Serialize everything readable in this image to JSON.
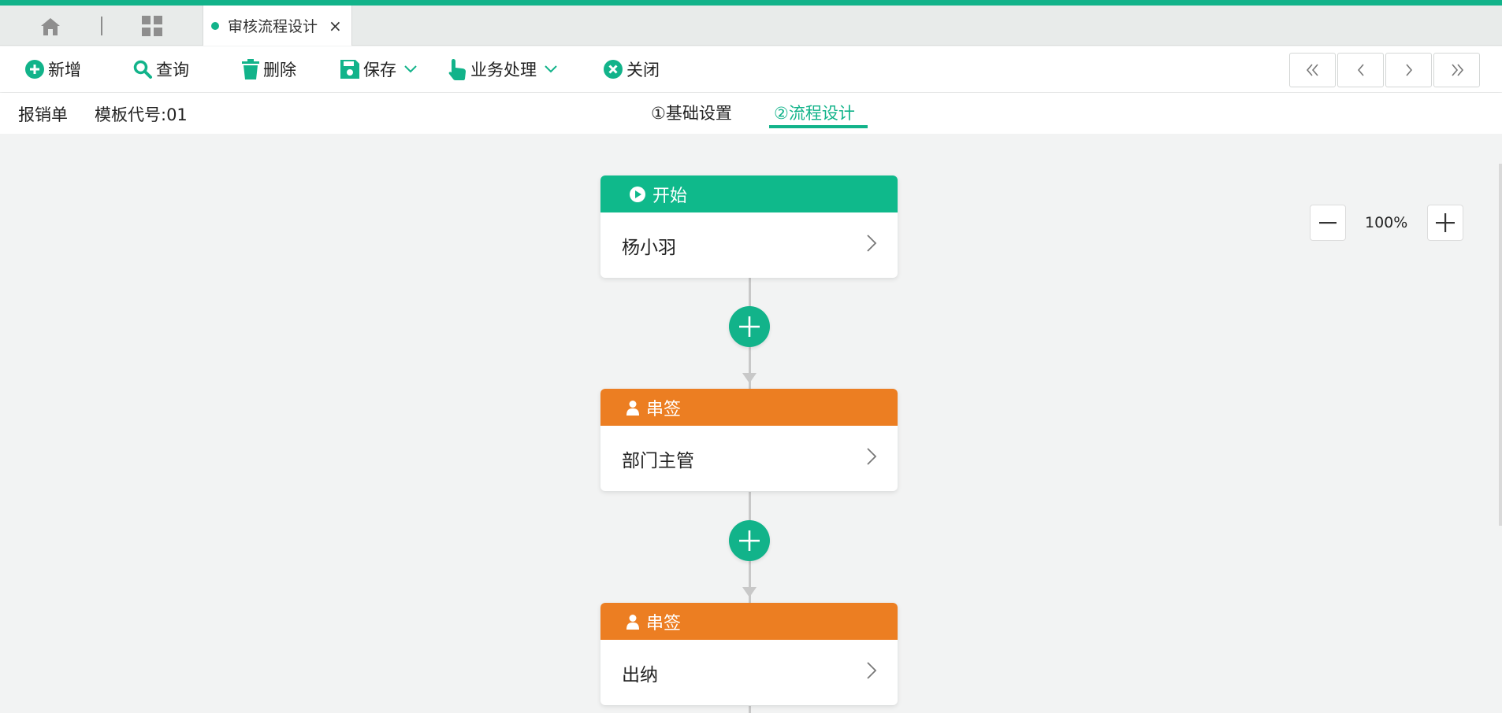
{
  "colors": {
    "accent": "#12b38a",
    "sign_node": "#ec7e22",
    "start_node": "#0fb98b"
  },
  "tabbar": {
    "home_icon": "home-icon",
    "apps_icon": "grid-icon",
    "active_tab": {
      "label": "审核流程设计",
      "close": "×"
    }
  },
  "toolbar": {
    "add_label": "新增",
    "query_label": "查询",
    "delete_label": "删除",
    "save_label": "保存",
    "business_label": "业务处理",
    "close_label": "关闭"
  },
  "pager": [
    "first-page-icon",
    "prev-page-icon",
    "next-page-icon",
    "last-page-icon"
  ],
  "subheader": {
    "doc_type": "报销单",
    "template_code": "模板代号:01",
    "steps": [
      {
        "label": "①基础设置",
        "active": false
      },
      {
        "label": "②流程设计",
        "active": true
      }
    ]
  },
  "canvas": {
    "zoom": {
      "level": "100%",
      "minus_icon": "minus-icon",
      "plus_icon": "plus-icon"
    },
    "nodes": [
      {
        "type": "start",
        "title": "开始",
        "body": "杨小羽"
      },
      {
        "type": "sign",
        "title": "串签",
        "body": "部门主管"
      },
      {
        "type": "sign",
        "title": "串签",
        "body": "出纳"
      }
    ]
  }
}
